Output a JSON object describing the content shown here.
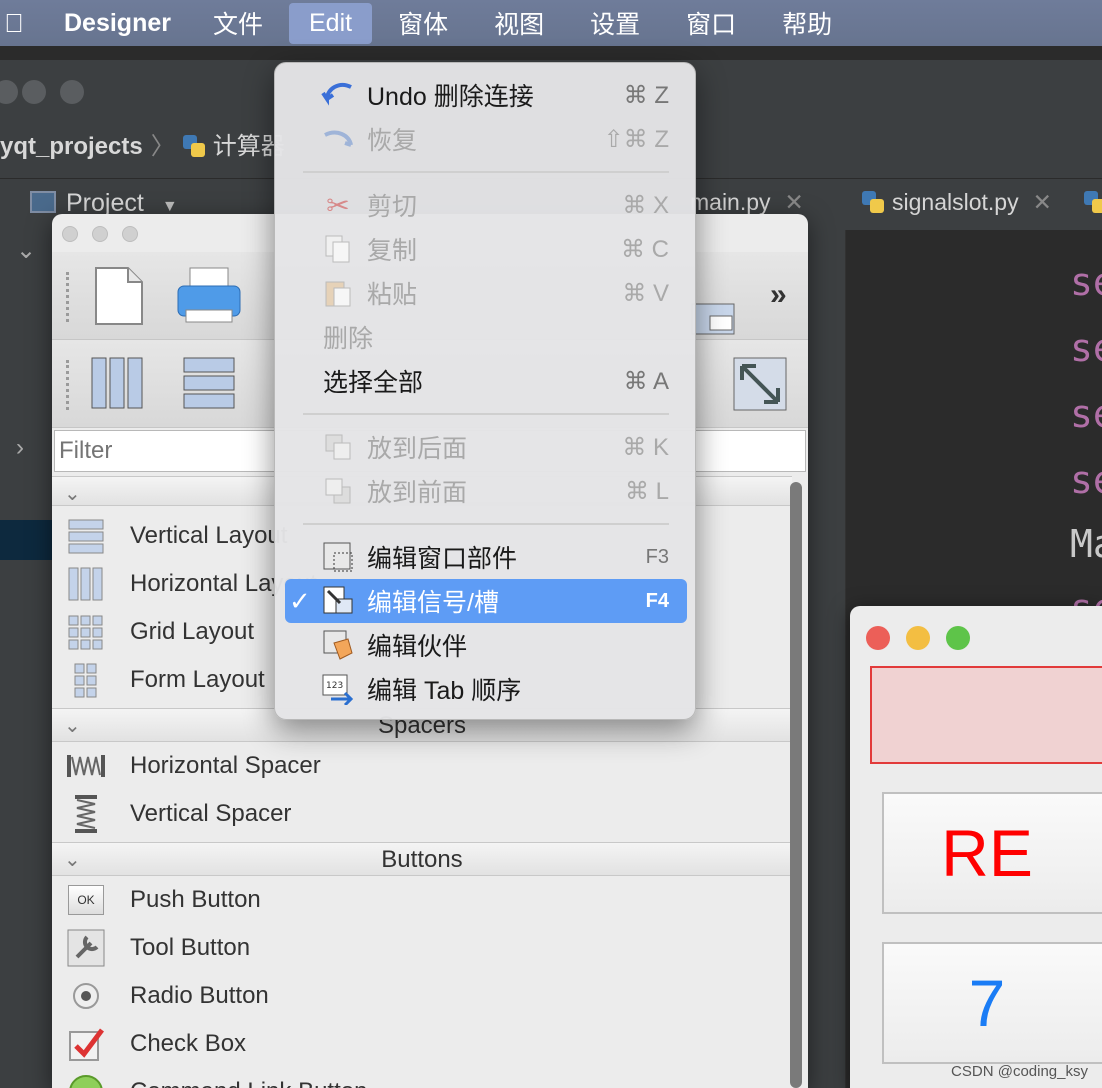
{
  "menubar": {
    "app_name": "Designer",
    "items": [
      "文件",
      "Edit",
      "窗体",
      "视图",
      "设置",
      "窗口",
      "帮助"
    ],
    "active_index": 1
  },
  "ide": {
    "breadcrumb": {
      "project": "yqt_projects",
      "file": "计算器"
    },
    "project_tab": "Project",
    "editor_tabs": [
      {
        "label": "main.py"
      },
      {
        "label": "signalslot.py"
      }
    ],
    "code_lines": [
      "se",
      "se",
      "se",
      "se",
      "Ma",
      "se"
    ]
  },
  "widget_box": {
    "filter_placeholder": "Filter",
    "layouts": [
      {
        "label": "Vertical Layout"
      },
      {
        "label": "Horizontal Layout"
      },
      {
        "label": "Grid Layout"
      },
      {
        "label": "Form Layout"
      }
    ],
    "spacers_header": "Spacers",
    "spacers": [
      {
        "label": "Horizontal Spacer"
      },
      {
        "label": "Vertical Spacer"
      }
    ],
    "buttons_header": "Buttons",
    "buttons": [
      {
        "label": "Push Button",
        "icon_text": "OK"
      },
      {
        "label": "Tool Button"
      },
      {
        "label": "Radio Button"
      },
      {
        "label": "Check Box"
      },
      {
        "label": "Command Link Button"
      }
    ]
  },
  "edit_menu": {
    "items": [
      {
        "label": "Undo 删除连接",
        "shortcut": "⌘ Z",
        "enabled": true
      },
      {
        "label": "恢复",
        "shortcut": "⇧⌘ Z",
        "enabled": false
      },
      {
        "label": "剪切",
        "shortcut": "⌘ X",
        "enabled": false
      },
      {
        "label": "复制",
        "shortcut": "⌘ C",
        "enabled": false
      },
      {
        "label": "粘贴",
        "shortcut": "⌘ V",
        "enabled": false
      },
      {
        "label": "删除",
        "shortcut": "",
        "enabled": false
      },
      {
        "label": "选择全部",
        "shortcut": "⌘ A",
        "enabled": true
      },
      {
        "label": "放到后面",
        "shortcut": "⌘ K",
        "enabled": false
      },
      {
        "label": "放到前面",
        "shortcut": "⌘ L",
        "enabled": false
      },
      {
        "label": "编辑窗口部件",
        "shortcut": "F3",
        "enabled": true
      },
      {
        "label": "编辑信号/槽",
        "shortcut": "F4",
        "enabled": true,
        "checked": true
      },
      {
        "label": "编辑伙伴",
        "shortcut": "",
        "enabled": true
      },
      {
        "label": "编辑 Tab 顺序",
        "shortcut": "",
        "enabled": true
      }
    ]
  },
  "form_preview": {
    "buttons": [
      "RE",
      "7"
    ],
    "colors": {
      "re": "#ff0000",
      "seven": "#1a7cf5"
    }
  },
  "watermark": "CSDN @coding_ksy"
}
